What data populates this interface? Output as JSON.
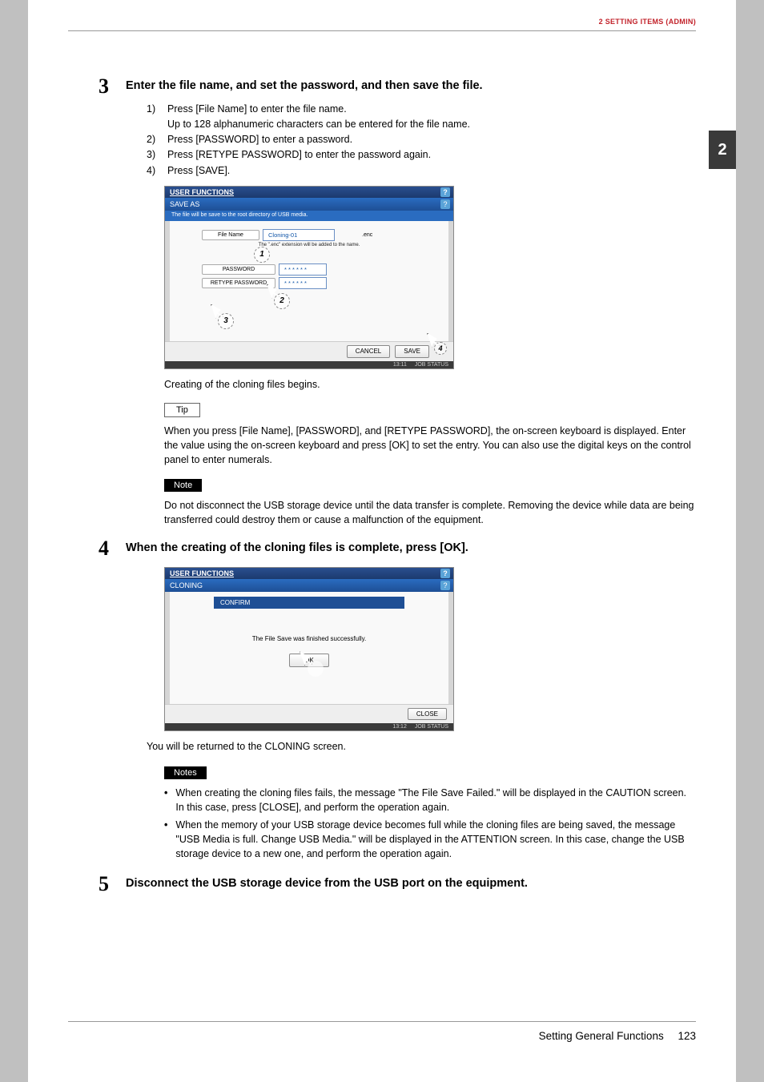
{
  "header": {
    "section": "2 SETTING ITEMS (ADMIN)"
  },
  "side_tab": "2",
  "steps": {
    "s3": {
      "num": "3",
      "title": "Enter the file name, and set the password, and then save the file.",
      "items": [
        {
          "n": "1)",
          "t": "Press [File Name] to enter the file name."
        },
        {
          "n": "",
          "t": "Up to 128 alphanumeric characters can be entered for the file name."
        },
        {
          "n": "2)",
          "t": "Press [PASSWORD] to enter a password."
        },
        {
          "n": "3)",
          "t": "Press [RETYPE PASSWORD] to enter the password again."
        },
        {
          "n": "4)",
          "t": "Press [SAVE]."
        }
      ],
      "after": "Creating of the cloning files begins."
    },
    "s4": {
      "num": "4",
      "title": "When the creating of the cloning files is complete, press [OK].",
      "after": "You will be returned to the CLONING screen."
    },
    "s5": {
      "num": "5",
      "title": "Disconnect the USB storage device from the USB port on the equipment."
    }
  },
  "ss1": {
    "topbar": "USER FUNCTIONS",
    "sub": "SAVE AS",
    "hint": "The file will be save to the root directory of USB media.",
    "file_label": "File Name",
    "file_value": "Cloning-01",
    "file_ext": ".enc",
    "file_note": "The \".enc\" extension will be added to the name.",
    "pwd_label": "PASSWORD",
    "pwd_value": "* * * * * *",
    "rpwd_label": "RETYPE PASSWORD",
    "rpwd_value": "* * * * * *",
    "cancel": "CANCEL",
    "save": "SAVE",
    "jobstatus": "JOB STATUS",
    "time": "13:11",
    "c1": "1",
    "c2": "2",
    "c3": "3",
    "c4": "4"
  },
  "ss2": {
    "topbar": "USER FUNCTIONS",
    "sub": "CLONING",
    "confirm": "CONFIRM",
    "msg": "The File Save was finished successfully.",
    "ok": "OK",
    "close": "CLOSE",
    "jobstatus": "JOB STATUS",
    "time": "13:12"
  },
  "tip": {
    "label": "Tip",
    "text": "When you press [File Name], [PASSWORD], and [RETYPE PASSWORD], the on-screen keyboard is displayed. Enter the value using the on-screen keyboard and press [OK] to set the entry. You can also use the digital keys on the control panel to enter numerals."
  },
  "note1": {
    "label": "Note",
    "text": "Do not disconnect the USB storage device until the data transfer is complete. Removing the device while data are being transferred could destroy them or cause a malfunction of the equipment."
  },
  "notes2": {
    "label": "Notes",
    "items": [
      "When creating the cloning files fails, the message \"The File Save Failed.\" will be displayed in the CAUTION screen. In this case, press [CLOSE], and perform the operation again.",
      "When the memory of your USB storage device becomes full while the cloning files are being saved, the message \"USB Media is full. Change USB Media.\" will be displayed in the ATTENTION screen. In this case, change the USB storage device to a new one, and perform the operation again."
    ]
  },
  "footer": {
    "section": "Setting General Functions",
    "page": "123"
  }
}
